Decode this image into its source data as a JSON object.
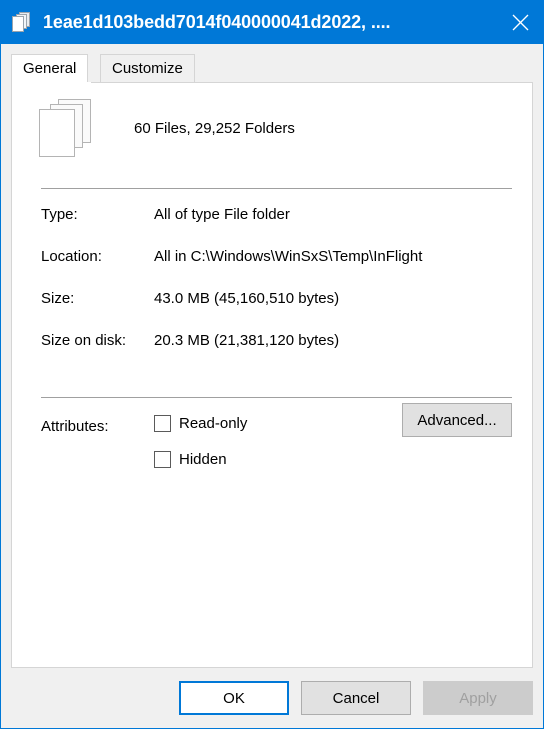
{
  "window": {
    "title": "1eae1d103bedd7014f040000041d2022, ....",
    "title_icon": "stacked-documents-icon",
    "close_icon": "close-icon",
    "accent_color": "#0078d7",
    "background_color": "#f0f0f0",
    "panel_color": "#ffffff"
  },
  "tabs": [
    {
      "label": "General",
      "active": true
    },
    {
      "label": "Customize",
      "active": false
    }
  ],
  "header": {
    "icon": "stacked-documents-icon",
    "summary": "60 Files, 29,252 Folders"
  },
  "details": [
    {
      "label": "Type:",
      "value": "All of type File folder"
    },
    {
      "label": "Location:",
      "value": "All in C:\\Windows\\WinSxS\\Temp\\InFlight"
    },
    {
      "label": "Size:",
      "value": "43.0 MB (45,160,510 bytes)"
    },
    {
      "label": "Size on disk:",
      "value": "20.3 MB (21,381,120 bytes)"
    }
  ],
  "attributes": {
    "label": "Attributes:",
    "checkboxes": [
      {
        "label": "Read-only",
        "checked": false
      },
      {
        "label": "Hidden",
        "checked": false
      }
    ],
    "advanced_label": "Advanced..."
  },
  "footer": {
    "ok_label": "OK",
    "cancel_label": "Cancel",
    "apply_label": "Apply",
    "apply_enabled": false
  }
}
